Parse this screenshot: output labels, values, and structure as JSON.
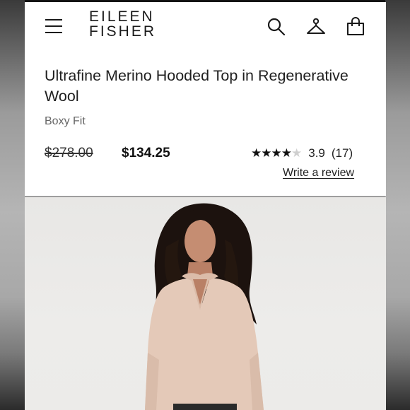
{
  "header": {
    "logo_line1": "EILEEN",
    "logo_line2": "FISHER",
    "icons": [
      "menu-icon",
      "search-icon",
      "account-icon",
      "bag-icon"
    ]
  },
  "product": {
    "title": "Ultrafine Merino Hooded Top in Regenerative Wool",
    "fit": "Boxy Fit",
    "original_price": "$278.00",
    "sale_price": "$134.25",
    "rating": {
      "stars_filled": 4,
      "stars_total": 5,
      "value": "3.9",
      "count": "(17)"
    },
    "review_link": "Write a review"
  },
  "image": {
    "subject": "model-photo",
    "sweater_color": "#e4c9b8"
  }
}
